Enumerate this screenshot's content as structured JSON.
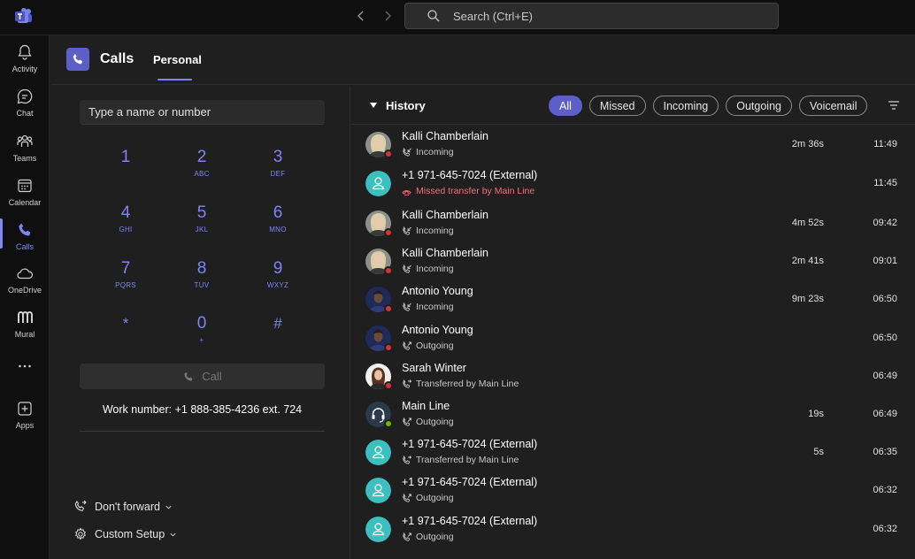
{
  "search": {
    "placeholder": "Search (Ctrl+E)"
  },
  "rail": [
    {
      "label": "Activity",
      "icon": "bell-icon"
    },
    {
      "label": "Chat",
      "icon": "chat-icon"
    },
    {
      "label": "Teams",
      "icon": "teams-icon"
    },
    {
      "label": "Calendar",
      "icon": "calendar-icon"
    },
    {
      "label": "Calls",
      "icon": "phone-icon"
    },
    {
      "label": "OneDrive",
      "icon": "cloud-icon"
    },
    {
      "label": "Mural",
      "icon": "mural-icon"
    },
    {
      "label": "Apps",
      "icon": "apps-icon"
    }
  ],
  "header": {
    "title": "Calls",
    "tab": "Personal"
  },
  "dialpad": {
    "placeholder": "Type a name or number",
    "keys": [
      {
        "digit": "1",
        "letters": ""
      },
      {
        "digit": "2",
        "letters": "ABC"
      },
      {
        "digit": "3",
        "letters": "DEF"
      },
      {
        "digit": "4",
        "letters": "GHI"
      },
      {
        "digit": "5",
        "letters": "JKL"
      },
      {
        "digit": "6",
        "letters": "MNO"
      },
      {
        "digit": "7",
        "letters": "PQRS"
      },
      {
        "digit": "8",
        "letters": "TUV"
      },
      {
        "digit": "9",
        "letters": "WXYZ"
      },
      {
        "digit": "*",
        "letters": ""
      },
      {
        "digit": "0",
        "letters": "+"
      },
      {
        "digit": "#",
        "letters": ""
      }
    ],
    "call_label": "Call",
    "work_number": "Work number: +1 888-385-4236 ext. 724",
    "forward_label": "Don't forward",
    "setup_label": "Custom Setup"
  },
  "history": {
    "title": "History",
    "filters": [
      "All",
      "Missed",
      "Incoming",
      "Outgoing",
      "Voicemail"
    ],
    "active_filter": "All",
    "rows": [
      {
        "name": "Kalli Chamberlain",
        "sub": "Incoming",
        "dur": "2m 36s",
        "time": "11:49",
        "avatar": "kalli",
        "presence": "red",
        "kind": "incoming"
      },
      {
        "name": "+1 971-645-7024 (External)",
        "sub": "Missed transfer by Main Line",
        "dur": "",
        "time": "11:45",
        "avatar": "external",
        "presence": "",
        "kind": "missed"
      },
      {
        "name": "Kalli Chamberlain",
        "sub": "Incoming",
        "dur": "4m 52s",
        "time": "09:42",
        "avatar": "kalli",
        "presence": "red",
        "kind": "incoming"
      },
      {
        "name": "Kalli Chamberlain",
        "sub": "Incoming",
        "dur": "2m 41s",
        "time": "09:01",
        "avatar": "kalli",
        "presence": "red",
        "kind": "incoming"
      },
      {
        "name": "Antonio Young",
        "sub": "Incoming",
        "dur": "9m 23s",
        "time": "06:50",
        "avatar": "antonio",
        "presence": "red",
        "kind": "incoming"
      },
      {
        "name": "Antonio Young",
        "sub": "Outgoing",
        "dur": "",
        "time": "06:50",
        "avatar": "antonio",
        "presence": "red",
        "kind": "outgoing"
      },
      {
        "name": "Sarah Winter",
        "sub": "Transferred by Main Line",
        "dur": "",
        "time": "06:49",
        "avatar": "sarah",
        "presence": "red",
        "kind": "transfer"
      },
      {
        "name": "Main Line",
        "sub": "Outgoing",
        "dur": "19s",
        "time": "06:49",
        "avatar": "mainline",
        "presence": "green",
        "kind": "outgoing"
      },
      {
        "name": "+1 971-645-7024 (External)",
        "sub": "Transferred by Main Line",
        "dur": "5s",
        "time": "06:35",
        "avatar": "external",
        "presence": "",
        "kind": "transfer"
      },
      {
        "name": "+1 971-645-7024 (External)",
        "sub": "Outgoing",
        "dur": "",
        "time": "06:32",
        "avatar": "external",
        "presence": "",
        "kind": "outgoing"
      },
      {
        "name": "+1 971-645-7024 (External)",
        "sub": "Outgoing",
        "dur": "",
        "time": "06:32",
        "avatar": "external",
        "presence": "",
        "kind": "outgoing"
      }
    ]
  },
  "colors": {
    "accent": "#7f85f5",
    "brand": "#5b5fc7",
    "missed": "#f1707b",
    "external_avatar": "#3bbfbf"
  }
}
